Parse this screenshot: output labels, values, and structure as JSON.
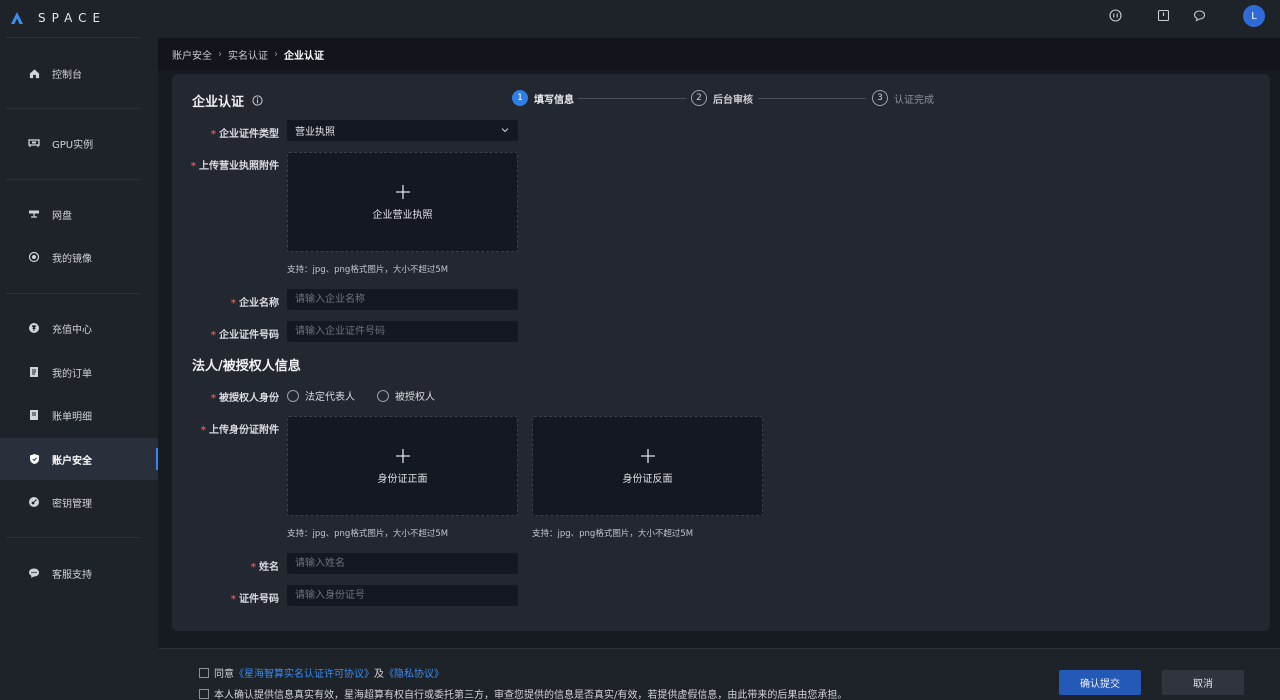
{
  "app": {
    "logo_text": "SPACE",
    "avatar_initial": "L",
    "accent": "#2f7ee8"
  },
  "sidebar": {
    "items": [
      {
        "label": "控制台",
        "icon": "home-icon"
      },
      {
        "label": "GPU实例",
        "icon": "gpu-icon"
      },
      {
        "label": "网盘",
        "icon": "disk-icon"
      },
      {
        "label": "我的镜像",
        "icon": "image-icon"
      },
      {
        "label": "充值中心",
        "icon": "yen-icon"
      },
      {
        "label": "我的订单",
        "icon": "order-icon"
      },
      {
        "label": "账单明细",
        "icon": "bill-icon"
      },
      {
        "label": "账户安全",
        "icon": "shield-icon",
        "active": true
      },
      {
        "label": "密钥管理",
        "icon": "key-icon"
      },
      {
        "label": "客服支持",
        "icon": "chat-icon"
      }
    ]
  },
  "breadcrumb": [
    "账户安全",
    "实名认证",
    "企业认证"
  ],
  "card": {
    "title": "企业认证",
    "steps": [
      {
        "num": "1",
        "label": "填写信息"
      },
      {
        "num": "2",
        "label": "后台审核"
      },
      {
        "num": "3",
        "label": "认证完成"
      }
    ]
  },
  "form": {
    "cert_type_label": "企业证件类型",
    "cert_type_value": "营业执照",
    "license_upload_label": "上传营业执照附件",
    "license_upload_text": "企业营业执照",
    "upload_hint": "支持：jpg、png格式图片，大小不超过5M",
    "company_name_label": "企业名称",
    "company_name_placeholder": "请输入企业名称",
    "company_id_label": "企业证件号码",
    "company_id_placeholder": "请输入企业证件号码"
  },
  "legal": {
    "section_title": "法人/被授权人信息",
    "identity_label": "被授权人身份",
    "options": [
      "法定代表人",
      "被授权人"
    ],
    "id_upload_label": "上传身份证附件",
    "id_front_text": "身份证正面",
    "id_back_text": "身份证反面",
    "name_label": "姓名",
    "name_placeholder": "请输入姓名",
    "id_number_label": "证件号码",
    "id_number_placeholder": "请输入身份证号"
  },
  "footer": {
    "agree_prefix": "同意",
    "agreement_link": "《星海智算实名认证许可协议》",
    "and": "及",
    "privacy_link": "《隐私协议》",
    "confirm_text": "本人确认提供信息真实有效，星海超算有权自行或委托第三方，审查您提供的信息是否真实/有效，若提供虚假信息，由此带来的后果由您承担。",
    "submit": "确认提交",
    "cancel": "取消"
  }
}
